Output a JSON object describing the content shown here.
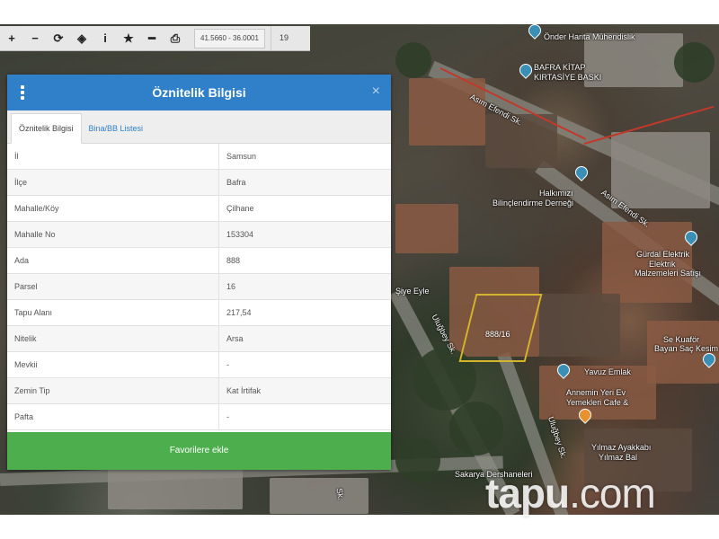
{
  "toolbar": {
    "coordinates": "41.5660 - 36.0001",
    "zoom": "19"
  },
  "panel": {
    "title": "Öznitelik Bilgisi",
    "close": "×",
    "tabs": [
      {
        "label": "Öznitelik Bilgisi",
        "active": true
      },
      {
        "label": "Bina/BB Listesi",
        "active": false
      }
    ],
    "rows": [
      {
        "key": "İl",
        "value": "Samsun"
      },
      {
        "key": "İlçe",
        "value": "Bafra"
      },
      {
        "key": "Mahalle/Köy",
        "value": "Çilhane"
      },
      {
        "key": "Mahalle No",
        "value": "153304"
      },
      {
        "key": "Ada",
        "value": "888"
      },
      {
        "key": "Parsel",
        "value": "16"
      },
      {
        "key": "Tapu Alanı",
        "value": "217,54"
      },
      {
        "key": "Nitelik",
        "value": "Arsa"
      },
      {
        "key": "Mevkii",
        "value": "-"
      },
      {
        "key": "Zemin Tip",
        "value": "Kat İrtifak"
      },
      {
        "key": "Pafta",
        "value": "-"
      }
    ],
    "favorite_button": "Favorilere ekle"
  },
  "map": {
    "labels": {
      "harita": "Önder Harita Mühendislik",
      "kitap1": "BAFRA KİTAP",
      "kitap2": "KIRTASİYE BASKI",
      "asim1": "Asım Efendi Sk.",
      "asim2": "Asım Efendi Sk.",
      "dernek1": "Halkımızı",
      "dernek2": "Bilinçlendirme Derneği",
      "elektrik1": "Gürdal Elektrik",
      "elektrik2": "Elektrik",
      "elektrik3": "Malzemeleri Satışı",
      "kuafor1": "Se Kuaför",
      "kuafor2": "Bayan Saç Kesim",
      "eyle": "Şiye Eyle",
      "ulugbey1": "Uluğbey Sk.",
      "ulugbey2": "Uluğbey Sk.",
      "emlak": "Yavuz Emlak",
      "annemin1": "Annemin Yeri Ev",
      "annemin2": "Yemekleri Cafe &",
      "ayakkabi1": "Yılmaz Ayakkabı",
      "ayakkabi2": "Yılmaz Bal",
      "sakarya": "Sakarya Dershaneleri",
      "sk": "Sk."
    },
    "parcel_label": "888/16"
  },
  "watermark": {
    "brand": "tapu",
    "dot": ".",
    "tld": "com"
  }
}
